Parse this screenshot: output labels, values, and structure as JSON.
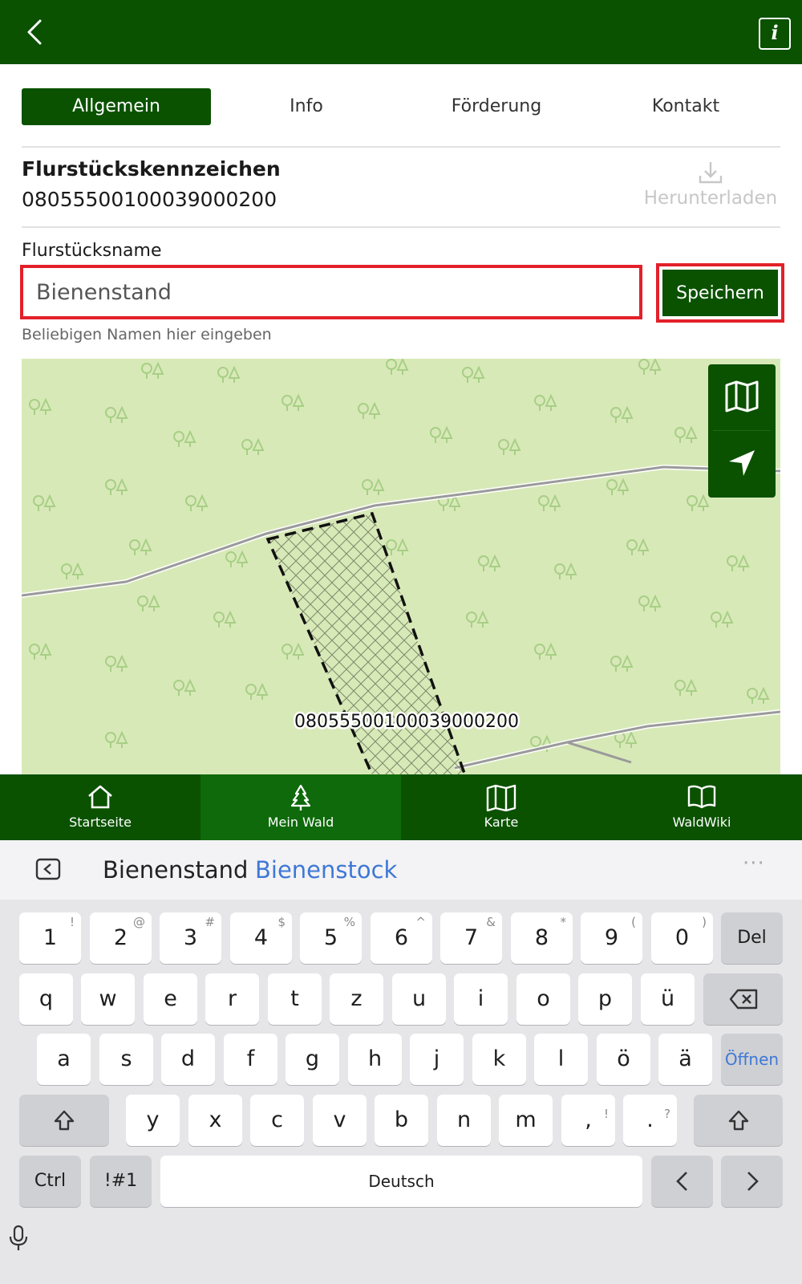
{
  "header": {
    "back_icon": "back-chevron-icon",
    "info_icon": "info-icon",
    "info_glyph": "i",
    "background": "#0a5200"
  },
  "tabs": [
    {
      "label": "Allgemein",
      "active": true
    },
    {
      "label": "Info",
      "active": false
    },
    {
      "label": "Förderung",
      "active": false
    },
    {
      "label": "Kontakt",
      "active": false
    }
  ],
  "parcel": {
    "id_label": "Flurstückskennzeichen",
    "id_value": "080555001000390002​00",
    "download_label": "Herunterladen",
    "download_icon": "download-icon"
  },
  "name_field": {
    "label": "Flurstücksname",
    "value": "Bienenstand",
    "hint": "Beliebigen Namen hier eingeben",
    "save_label": "Speichern",
    "highlight_color": "#e3202a"
  },
  "map": {
    "parcel_label": "080555001000390002​00",
    "controls": [
      "map-icon",
      "locate-arrow-icon"
    ],
    "fill_color": "#d8e9b8"
  },
  "bottom_nav": [
    {
      "label": "Startseite",
      "icon": "home-icon",
      "active": false
    },
    {
      "label": "Mein Wald",
      "icon": "tree-icon",
      "active": true
    },
    {
      "label": "Karte",
      "icon": "map-icon",
      "active": false
    },
    {
      "label": "WaldWiki",
      "icon": "book-icon",
      "active": false
    }
  ],
  "keyboard": {
    "suggestion_typed": "Bienenstand",
    "suggestion_word": "Bienenstock",
    "suggestion_more": "···",
    "row1": [
      {
        "key": "1",
        "alt": "!"
      },
      {
        "key": "2",
        "alt": "@"
      },
      {
        "key": "3",
        "alt": "#"
      },
      {
        "key": "4",
        "alt": "$"
      },
      {
        "key": "5",
        "alt": "%"
      },
      {
        "key": "6",
        "alt": "^"
      },
      {
        "key": "7",
        "alt": "&"
      },
      {
        "key": "8",
        "alt": "*"
      },
      {
        "key": "9",
        "alt": "("
      },
      {
        "key": "0",
        "alt": ")"
      }
    ],
    "del_label": "Del",
    "row2": [
      "q",
      "w",
      "e",
      "r",
      "t",
      "z",
      "u",
      "i",
      "o",
      "p",
      "ü"
    ],
    "row3": [
      "a",
      "s",
      "d",
      "f",
      "g",
      "h",
      "j",
      "k",
      "l",
      "ö",
      "ä"
    ],
    "open_label": "Öffnen",
    "row4": [
      "y",
      "x",
      "c",
      "v",
      "b",
      "n",
      "m"
    ],
    "comma": {
      "key": ",",
      "alt": "!"
    },
    "period": {
      "key": ".",
      "alt": "?"
    },
    "ctrl_label": "Ctrl",
    "symbols_label": "!#1",
    "space_label": "Deutsch"
  }
}
